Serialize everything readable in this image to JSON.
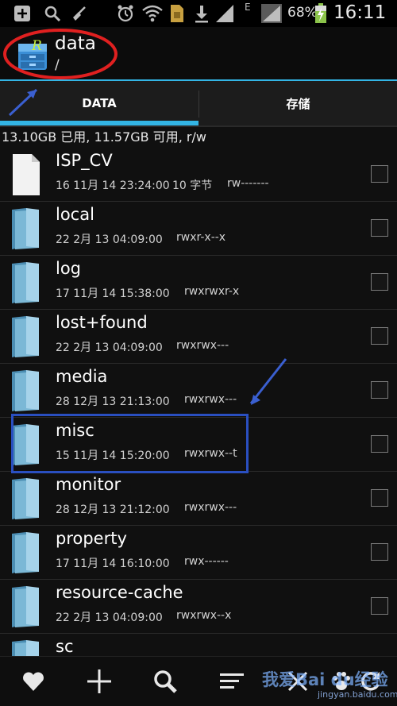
{
  "status_bar": {
    "battery_pct": "68%",
    "time": "16:11",
    "network_label": "E"
  },
  "header": {
    "title": "data",
    "path": "/"
  },
  "tabs": [
    {
      "label": "DATA",
      "active": true
    },
    {
      "label": "存储",
      "active": false
    }
  ],
  "storage_info": "13.10GB 已用, 11.57GB 可用, r/w",
  "files": [
    {
      "name": "ISP_CV",
      "date": "16 11月 14 23:24:00",
      "size": "10 字节",
      "perm": "rw-------",
      "type": "file"
    },
    {
      "name": "local",
      "date": "22 2月 13 04:09:00",
      "size": "",
      "perm": "rwxr-x--x",
      "type": "folder"
    },
    {
      "name": "log",
      "date": "17 11月 14 15:38:00",
      "size": "",
      "perm": "rwxrwxr-x",
      "type": "folder"
    },
    {
      "name": "lost+found",
      "date": "22 2月 13 04:09:00",
      "size": "",
      "perm": "rwxrwx---",
      "type": "folder"
    },
    {
      "name": "media",
      "date": "28 12月 13 21:13:00",
      "size": "",
      "perm": "rwxrwx---",
      "type": "folder"
    },
    {
      "name": "misc",
      "date": "15 11月 14 15:20:00",
      "size": "",
      "perm": "rwxrwx--t",
      "type": "folder"
    },
    {
      "name": "monitor",
      "date": "28 12月 13 21:12:00",
      "size": "",
      "perm": "rwxrwx---",
      "type": "folder"
    },
    {
      "name": "property",
      "date": "17 11月 14 16:10:00",
      "size": "",
      "perm": "rwx------",
      "type": "folder"
    },
    {
      "name": "resource-cache",
      "date": "22 2月 13 04:09:00",
      "size": "",
      "perm": "rwxrwx--x",
      "type": "folder"
    },
    {
      "name": "sc",
      "date": "",
      "size": "",
      "perm": "",
      "type": "folder"
    }
  ],
  "bottom_bar": [
    "heart-icon",
    "plus-icon",
    "search-icon",
    "menu-lines-icon",
    "close-icon",
    "paw-icon",
    "refresh-icon"
  ],
  "watermark": {
    "main": "我爱Bai du经验",
    "sub": "jingyan.baidu.com"
  },
  "colors": {
    "accent": "#33b5e5",
    "annotation_red": "#e02020",
    "annotation_blue": "#2a4fc0"
  }
}
